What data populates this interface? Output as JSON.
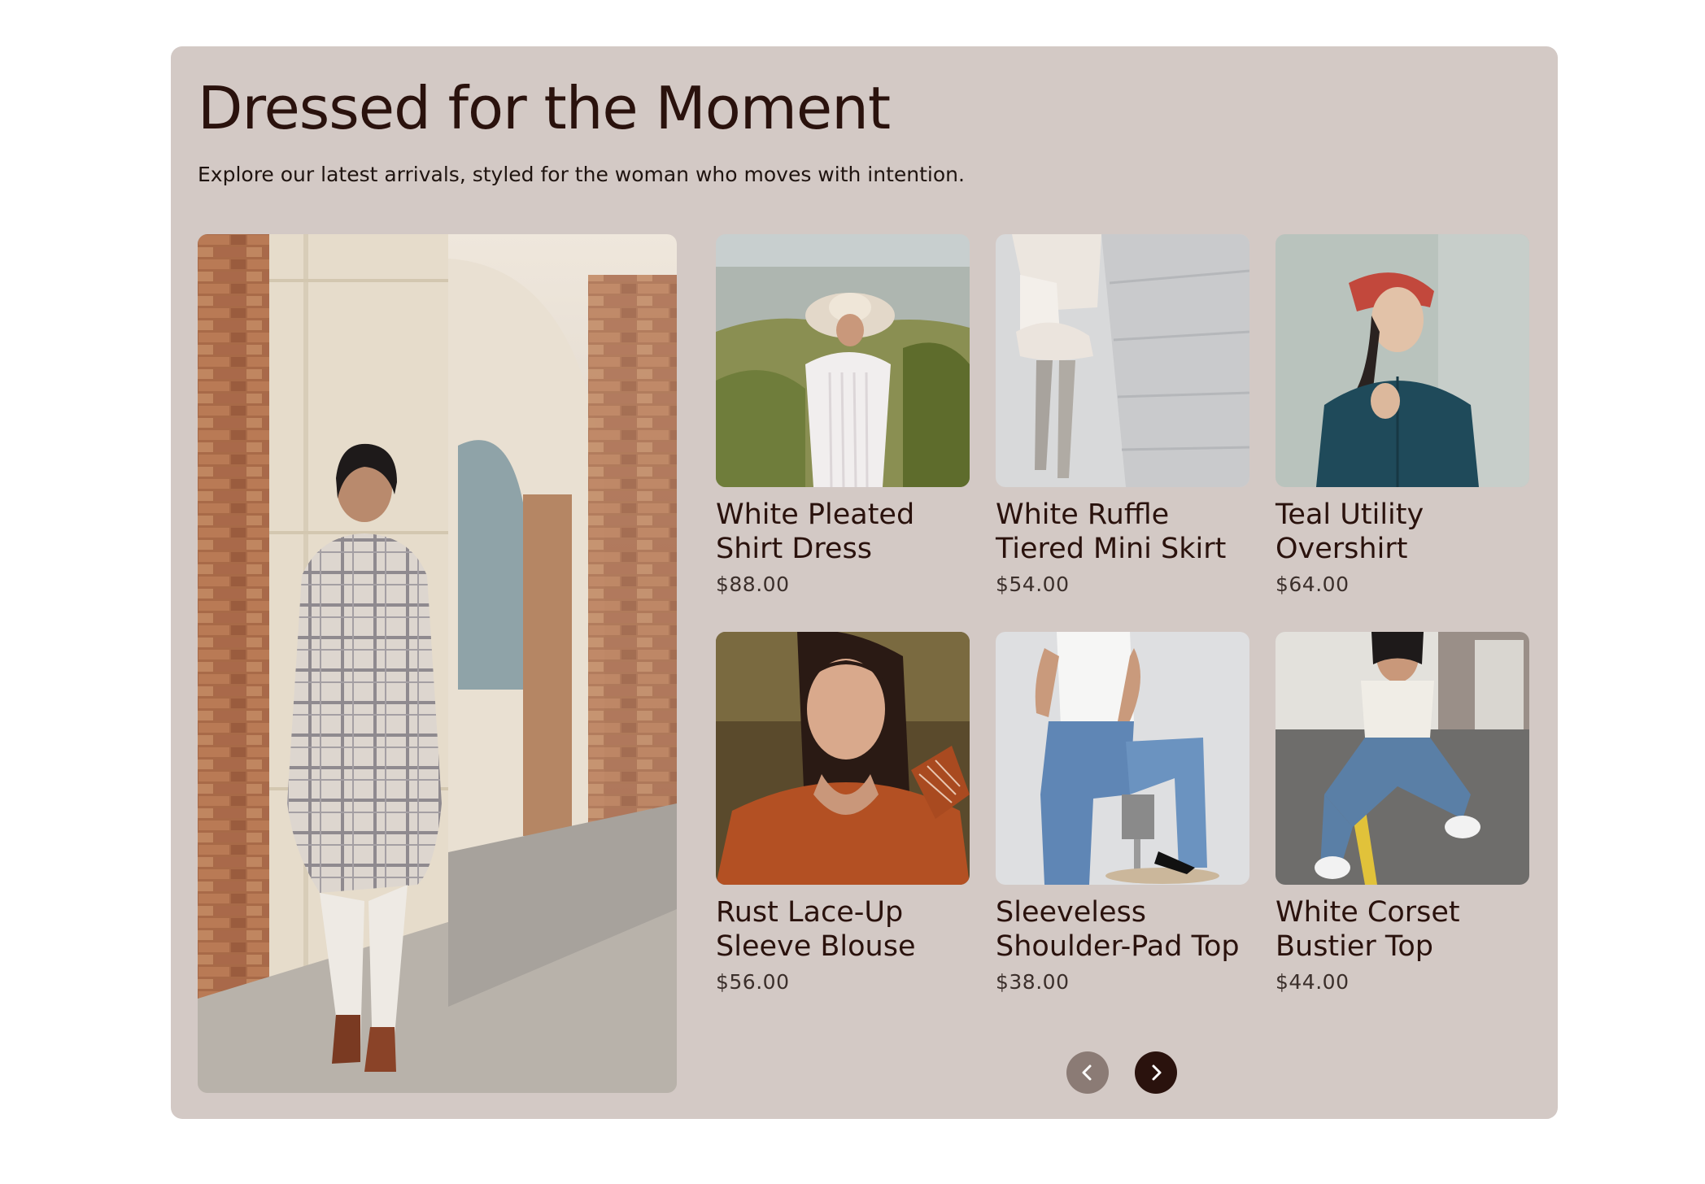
{
  "section": {
    "title": "Dressed for the Moment",
    "subtitle": "Explore our latest arrivals, styled for the woman who moves with intention."
  },
  "hero_image": {
    "icon": "hero-photo-woman-plaid-coat"
  },
  "products": [
    {
      "name": "White Pleated Shirt Dress",
      "price": "$88.00"
    },
    {
      "name": "White Ruffle Tiered Mini Skirt",
      "price": "$54.00"
    },
    {
      "name": "Teal Utility Overshirt",
      "price": "$64.00"
    },
    {
      "name": "Rust Lace-Up Sleeve Blouse",
      "price": "$56.00"
    },
    {
      "name": "Sleeveless Shoulder-Pad Top",
      "price": "$38.00"
    },
    {
      "name": "White Corset Bustier Top",
      "price": "$44.00"
    }
  ],
  "carousel": {
    "prev_icon": "chevron-left-icon",
    "next_icon": "chevron-right-icon"
  },
  "colors": {
    "panel": "#d3c9c5",
    "heading": "#2a120d",
    "nav_active": "#2a120d",
    "nav_inactive": "#8b7b75"
  }
}
